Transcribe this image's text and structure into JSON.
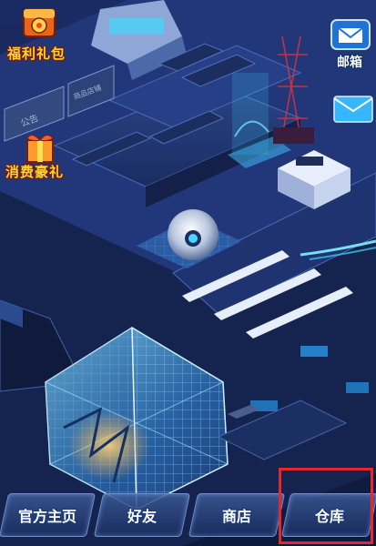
{
  "top_left": {
    "gift_pack_label": "福利礼包",
    "consume_gift_label": "消费豪礼"
  },
  "top_right": {
    "mailbox_label": "邮箱"
  },
  "scene": {
    "sign_left": "公告",
    "sign_middle": "商品店铺"
  },
  "bottom_nav": {
    "official_home": "官方主页",
    "friends": "好友",
    "shop": "商店",
    "warehouse": "仓库"
  },
  "colors": {
    "label_gold": "#ffd43a",
    "highlight_red": "#e8262b",
    "glow_cyan": "#3fd6ff"
  }
}
